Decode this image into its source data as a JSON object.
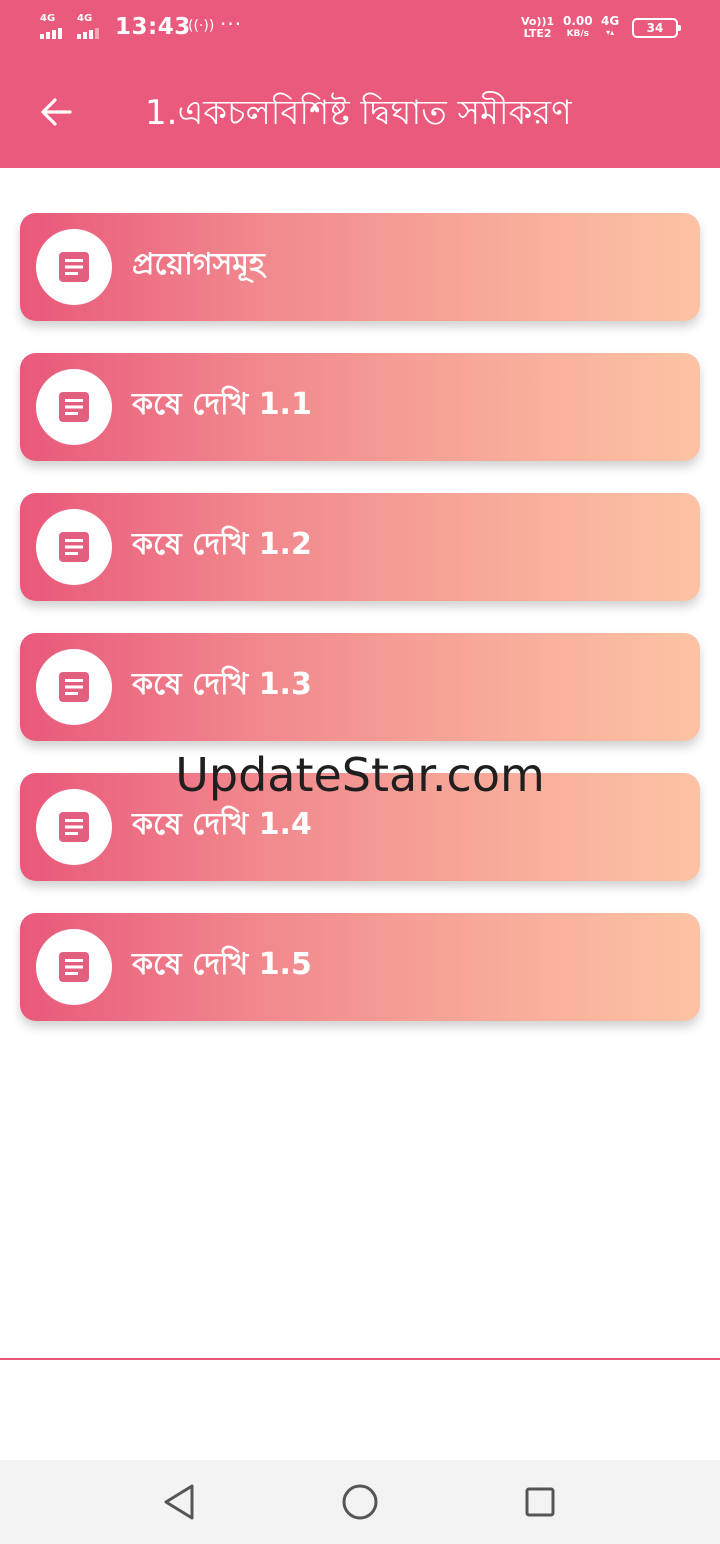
{
  "status_bar": {
    "sim1": "4G",
    "sim2": "4G",
    "time": "13:43",
    "hotspot_glyph": "((·))",
    "more_glyph": "···",
    "volte_top": "Vo))1",
    "volte_bottom": "LTE2",
    "speed_value": "0.00",
    "speed_unit": "KB/s",
    "network": "4G",
    "battery": "34"
  },
  "app_bar": {
    "back_icon": "arrow-left-icon",
    "title": "1.একচলবিশিষ্ট দ্বিঘাত সমীকরণ"
  },
  "list": {
    "items": [
      {
        "label": "প্রয়োগসমূহ",
        "icon": "document-icon"
      },
      {
        "label": "কষে দেখি 1.1",
        "icon": "document-icon"
      },
      {
        "label": "কষে দেখি 1.2",
        "icon": "document-icon"
      },
      {
        "label": "কষে দেখি 1.3",
        "icon": "document-icon"
      },
      {
        "label": "কষে দেখি 1.4",
        "icon": "document-icon"
      },
      {
        "label": "কষে দেখি 1.5",
        "icon": "document-icon"
      }
    ]
  },
  "watermark": "UpdateStar.com",
  "nav_bar": {
    "back": "back-triangle-icon",
    "home": "home-circle-icon",
    "recents": "recents-square-icon"
  },
  "colors": {
    "primary": "#ea5a7d",
    "gradient_start": "#e9587b",
    "gradient_end": "#fdc3a4",
    "icon_color": "#e35f7f"
  }
}
